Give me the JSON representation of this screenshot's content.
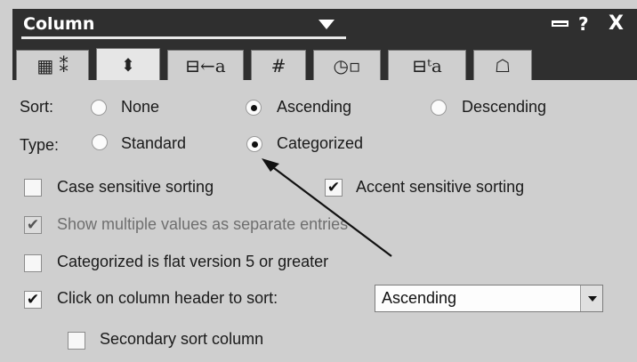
{
  "window": {
    "title": "Column",
    "title_dropdown_icon": "chevron-down-icon",
    "controls": {
      "help": "?",
      "close": "X"
    }
  },
  "tabs": [
    {
      "name": "basics",
      "icon": "table-icon",
      "glyph": "▦ ⁑",
      "active": false
    },
    {
      "name": "sorting",
      "icon": "sort-icon",
      "glyph": "⬍",
      "active": true
    },
    {
      "name": "font",
      "icon": "font-icon",
      "glyph": "⊟←a",
      "active": false
    },
    {
      "name": "numbers",
      "icon": "hash-icon",
      "glyph": "#",
      "active": false
    },
    {
      "name": "date-time",
      "icon": "clock-icon",
      "glyph": "◷▫",
      "active": false
    },
    {
      "name": "title",
      "icon": "title-font-icon",
      "glyph": "⊟ᵗa",
      "active": false
    },
    {
      "name": "advanced",
      "icon": "hat-icon",
      "glyph": "☖",
      "active": false
    }
  ],
  "sort": {
    "label": "Sort:",
    "options": [
      {
        "label": "None",
        "checked": false
      },
      {
        "label": "Ascending",
        "checked": true
      },
      {
        "label": "Descending",
        "checked": false
      }
    ]
  },
  "type": {
    "label": "Type:",
    "options": [
      {
        "label": "Standard",
        "checked": false
      },
      {
        "label": "Categorized",
        "checked": true
      }
    ]
  },
  "checkboxes": {
    "case_sensitive": {
      "label": "Case sensitive sorting",
      "checked": false,
      "enabled": true
    },
    "accent_sensitive": {
      "label": "Accent sensitive sorting",
      "checked": true,
      "enabled": true
    },
    "multiple_values": {
      "label": "Show multiple values as separate entries",
      "checked": true,
      "enabled": false
    },
    "flat_version": {
      "label": "Categorized is flat version 5 or greater",
      "checked": false,
      "enabled": true
    },
    "click_header": {
      "label": "Click on column header to sort:",
      "checked": true,
      "enabled": true
    },
    "secondary_sort": {
      "label": "Secondary sort column",
      "checked": false,
      "enabled": true
    }
  },
  "click_header_sort": {
    "selected": "Ascending"
  },
  "check_glyph": "✔"
}
